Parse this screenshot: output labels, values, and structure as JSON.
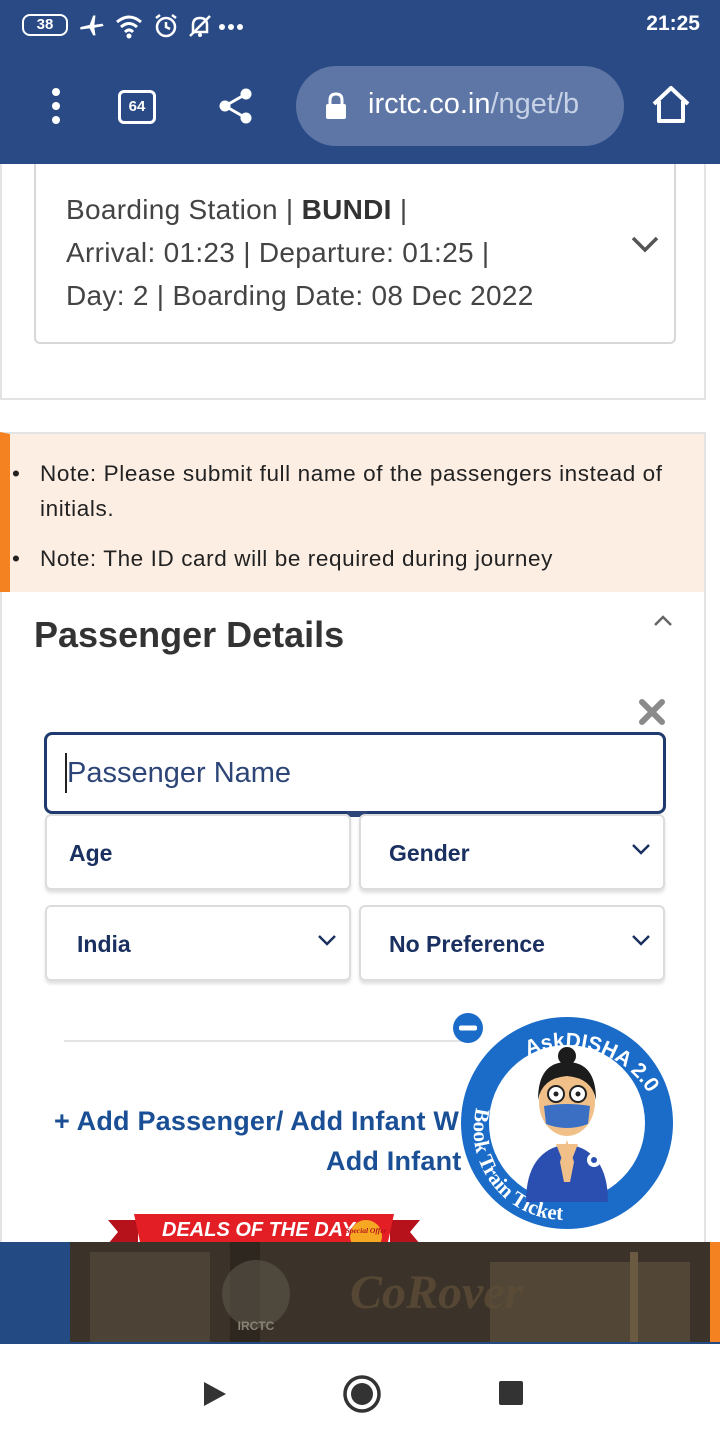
{
  "status_bar": {
    "battery": "38",
    "time": "21:25"
  },
  "browser": {
    "tab_count": "64",
    "url_host": "irctc.co.in",
    "url_path": "/nget/b"
  },
  "boarding": {
    "station_prefix": "Boarding Station | ",
    "station_name": "BUNDI",
    "station_suffix": " |",
    "times": "Arrival: 01:23 | Departure: 01:25 |",
    "day_date": "Day: 2 | Boarding Date: 08 Dec 2022"
  },
  "notes": [
    "Note: Please submit full name of the passengers instead of initials.",
    "Note: The ID card will be required during journey"
  ],
  "passenger_details": {
    "title": "Passenger Details",
    "name_placeholder": "Passenger Name",
    "age_label": "Age",
    "gender_label": "Gender",
    "nationality_value": "India",
    "berth_value": "No Preference",
    "add_passenger_label": "+ Add Passenger/ Add Infant W",
    "add_infant_label": "Add Infant"
  },
  "disha": {
    "top_text": "AskDISHA 2.0",
    "side_text": "Book Train Ticket"
  },
  "banner": {
    "deals_label": "DEALS OF THE DAY",
    "special_offer": "Special Offer",
    "logo_text": "IRCTC",
    "brand_text": "CoRover"
  },
  "colors": {
    "header_blue": "#2a4a85",
    "accent_orange": "#f58220",
    "link_blue": "#1b4f95",
    "note_bg": "#fdeee4"
  }
}
